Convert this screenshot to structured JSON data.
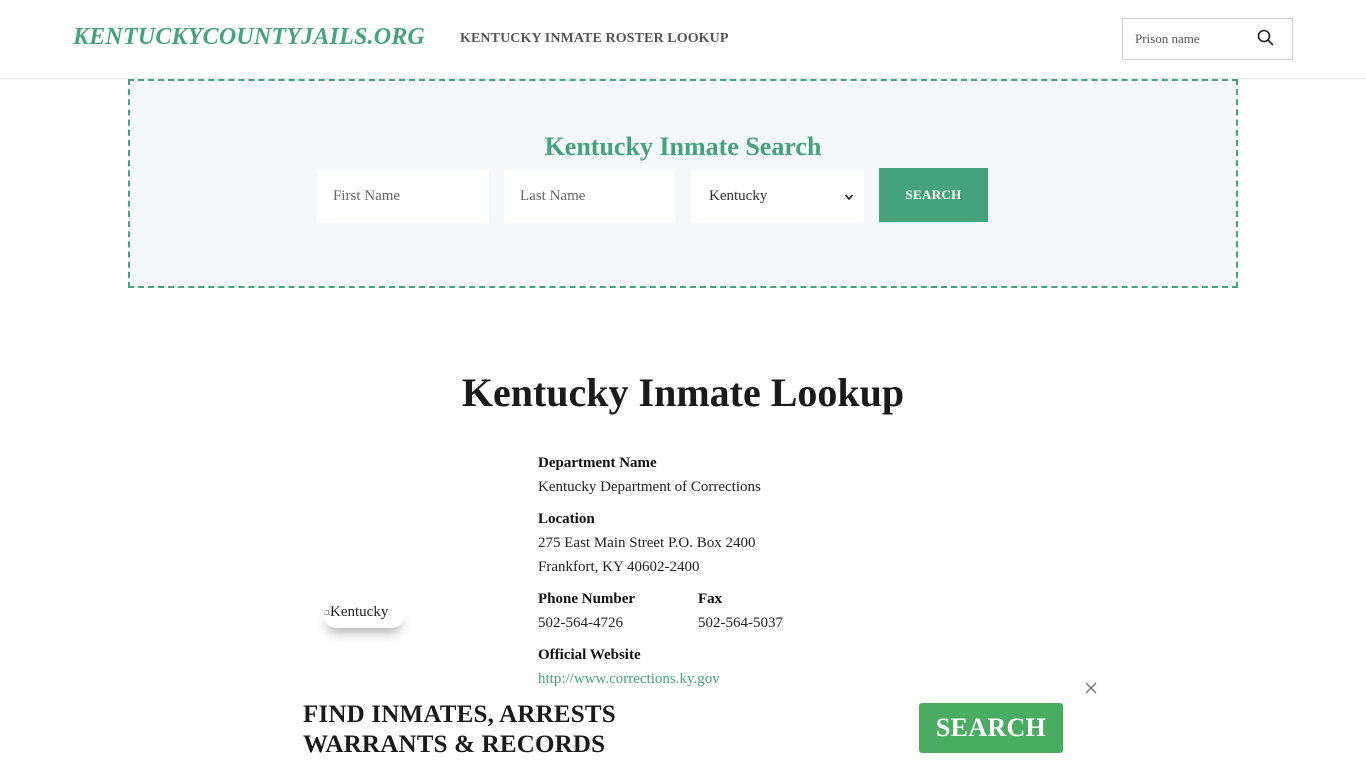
{
  "header": {
    "logo": "KENTUCKYCOUNTYJAILS.ORG",
    "nav_link": "KENTUCKY INMATE ROSTER LOOKUP",
    "search_placeholder": "Prison name",
    "search_icon": "search-icon"
  },
  "search_panel": {
    "title": "Kentucky Inmate Search",
    "first_name_placeholder": "First Name",
    "last_name_placeholder": "Last Name",
    "state_selected": "Kentucky",
    "search_label": "SEARCH"
  },
  "main": {
    "title": "Kentucky Inmate Lookup",
    "image_alt": "Kentucky",
    "department_label": "Department Name",
    "department_value": "Kentucky Department of Corrections",
    "location_label": "Location",
    "location_line1": "275 East Main Street P.O. Box 2400",
    "location_line2": "Frankfort, KY 40602-2400",
    "phone_label": "Phone Number",
    "phone_value": "502-564-4726",
    "fax_label": "Fax",
    "fax_value": "502-564-5037",
    "website_label": "Official Website",
    "website_value": "http://www.corrections.ky.gov"
  },
  "ad": {
    "line1": "FIND INMATES, ARRESTS",
    "line2": "WARRANTS & RECORDS",
    "button_label": "SEARCH",
    "close_icon": "close-icon"
  },
  "colors": {
    "brand_green": "#45a27c",
    "ad_button_green": "#4aac61",
    "panel_background": "#f5f8fa"
  }
}
